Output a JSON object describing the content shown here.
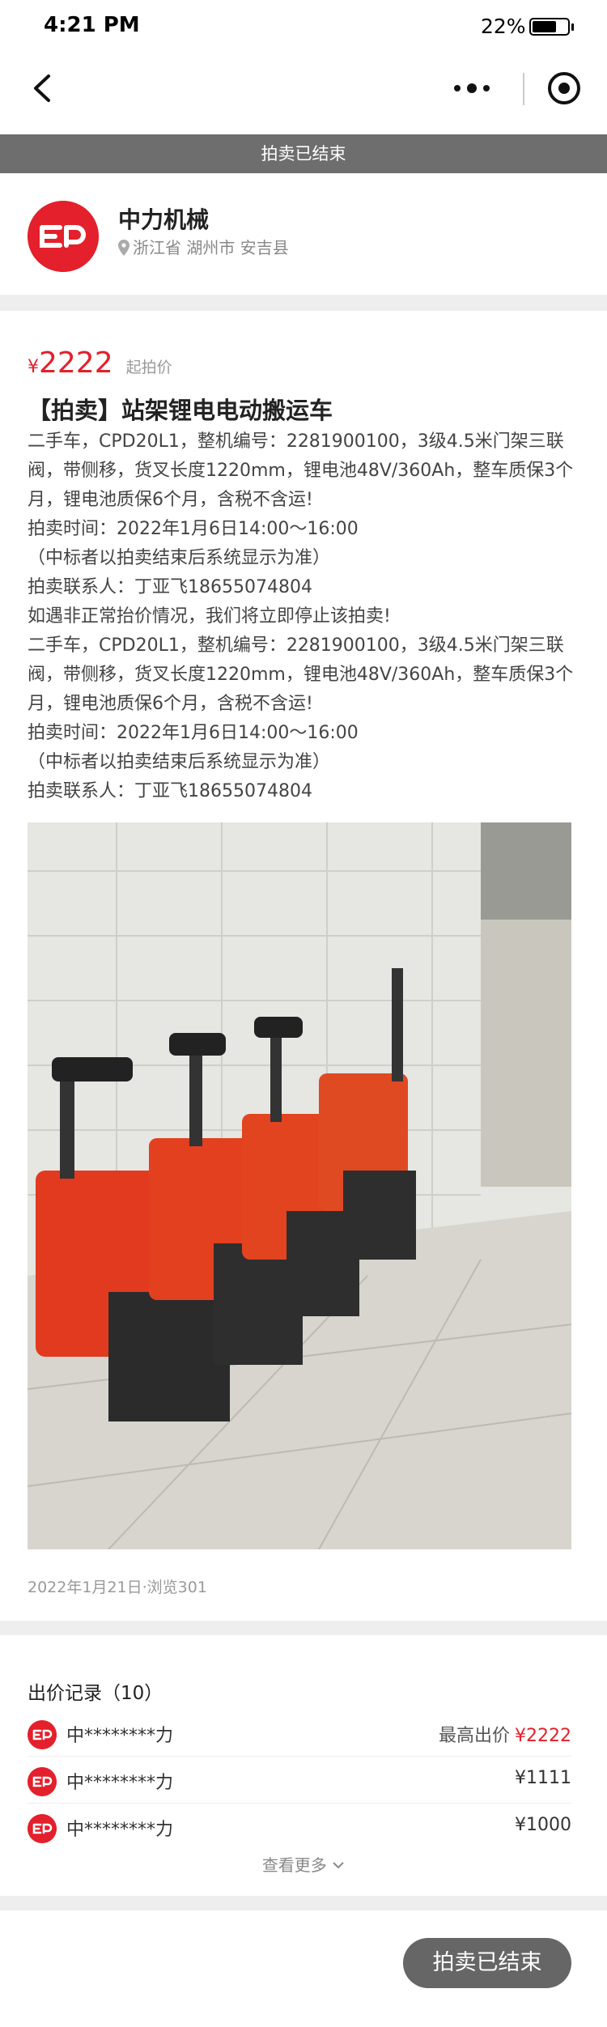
{
  "status_bar": {
    "time": "4:21 PM",
    "battery_percent_text": "22%",
    "battery_level": 0.22
  },
  "nav": {
    "back_icon": "chevron-left-icon",
    "more_icon": "more-dots-icon",
    "record_icon": "target-icon"
  },
  "banner": {
    "text": "拍卖已结束"
  },
  "seller": {
    "name": "中力机械",
    "location": "浙江省 湖州市 安吉县",
    "logo_color": "#e3202b"
  },
  "listing": {
    "price_symbol": "¥",
    "price": "2222",
    "price_label": "起拍价",
    "title": "【拍卖】站架锂电电动搬运车",
    "description_lines": [
      "二手车，CPD20L1，整机编号：2281900100，3级4.5米门架三联阀，带侧移，货叉长度1220mm，锂电池48V/360Ah，整车质保3个月，锂电池质保6个月，含税不含运!",
      "拍卖时间：2022年1月6日14:00～16:00",
      "（中标者以拍卖结束后系统显示为准）",
      "拍卖联系人：丁亚飞18655074804",
      "如遇非正常抬价情况，我们将立即停止该拍卖!",
      "二手车，CPD20L1，整机编号：2281900100，3级4.5米门架三联阀，带侧移，货叉长度1220mm，锂电池48V/360Ah，整车质保3个月，锂电池质保6个月，含税不含运!",
      "拍卖时间：2022年1月6日14:00～16:00",
      "（中标者以拍卖结束后系统显示为准）",
      "拍卖联系人：丁亚飞18655074804"
    ],
    "meta": "2022年1月21日·浏览301"
  },
  "bids": {
    "title": "出价记录（10）",
    "top_label": "最高出价",
    "rows": [
      {
        "user": "中********力",
        "price": "¥2222",
        "is_top": true
      },
      {
        "user": "中********力",
        "price": "¥1111",
        "is_top": false
      },
      {
        "user": "中********力",
        "price": "¥1000",
        "is_top": false
      }
    ],
    "see_more": "查看更多"
  },
  "bottom": {
    "button_label": "拍卖已结束"
  },
  "colors": {
    "accent": "#e3202b",
    "banner": "#6e6e6e",
    "button": "#666666"
  }
}
